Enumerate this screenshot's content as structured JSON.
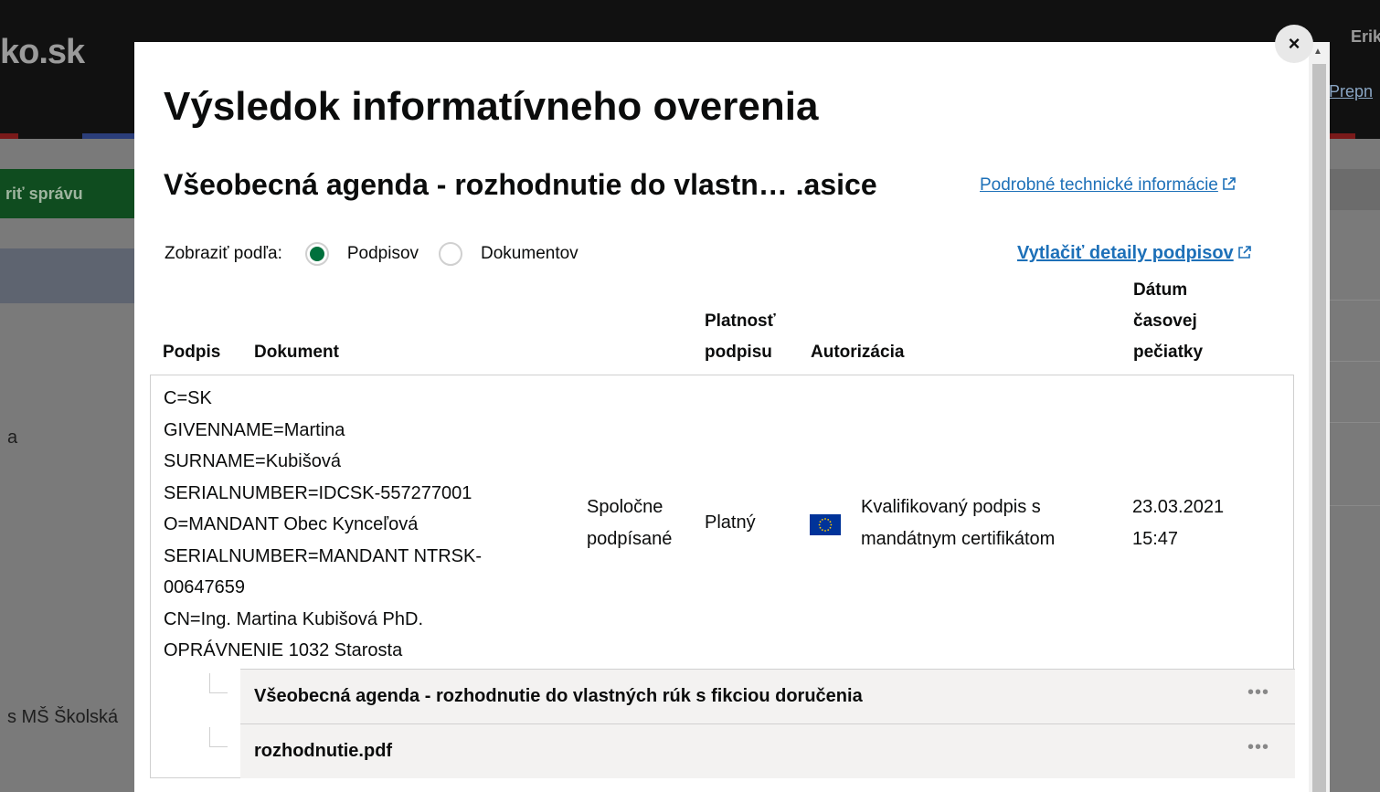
{
  "background": {
    "logo": "ko.sk",
    "user_name": "Erika I",
    "switch_link": "Prepn",
    "green_button": "riť správu",
    "side_text_a": "a",
    "side_text_ms": "s MŠ Školská"
  },
  "modal": {
    "close_label": "×",
    "title": "Výsledok informatívneho overenia",
    "subtitle": "Všeobecná agenda - rozhodnutie do vlastn… .asice",
    "tech_link": "Podrobné technické informácie",
    "print_link": "Vytlačiť detaily podpisov",
    "filter": {
      "label": "Zobraziť podľa:",
      "options": [
        {
          "label": "Podpisov",
          "selected": true
        },
        {
          "label": "Dokumentov",
          "selected": false
        }
      ]
    },
    "headers": {
      "signature": "Podpis",
      "document": "Dokument",
      "validity_1": "Platnosť",
      "validity_2": "podpisu",
      "authorization": "Autorizácia",
      "timestamp_1": "Dátum",
      "timestamp_2": "časovej",
      "timestamp_3": "pečiatky"
    },
    "signature": {
      "dn_lines": [
        "C=SK",
        "GIVENNAME=Martina",
        "SURNAME=Kubišová",
        "SERIALNUMBER=IDCSK-557277001",
        "O=MANDANT Obec Kynceľová",
        "SERIALNUMBER=MANDANT NTRSK-",
        "00647659",
        "CN=Ing. Martina Kubišová PhD.",
        "OPRÁVNENIE 1032 Starosta"
      ],
      "document_1": "Spoločne",
      "document_2": "podpísané",
      "validity": "Platný",
      "authorization_1": "Kvalifikovaný podpis s",
      "authorization_2": "mandátnym certifikátom",
      "date": "23.03.2021",
      "time": "15:47"
    },
    "documents": [
      {
        "name": "Všeobecná agenda - rozhodnutie do vlastných rúk s fikciou doručenia",
        "menu": "•••"
      },
      {
        "name": "rozhodnutie.pdf",
        "menu": "•••"
      }
    ]
  },
  "colors": {
    "link": "#1d70b8",
    "radio_selected": "#00703c",
    "eu_flag": "#003399"
  }
}
